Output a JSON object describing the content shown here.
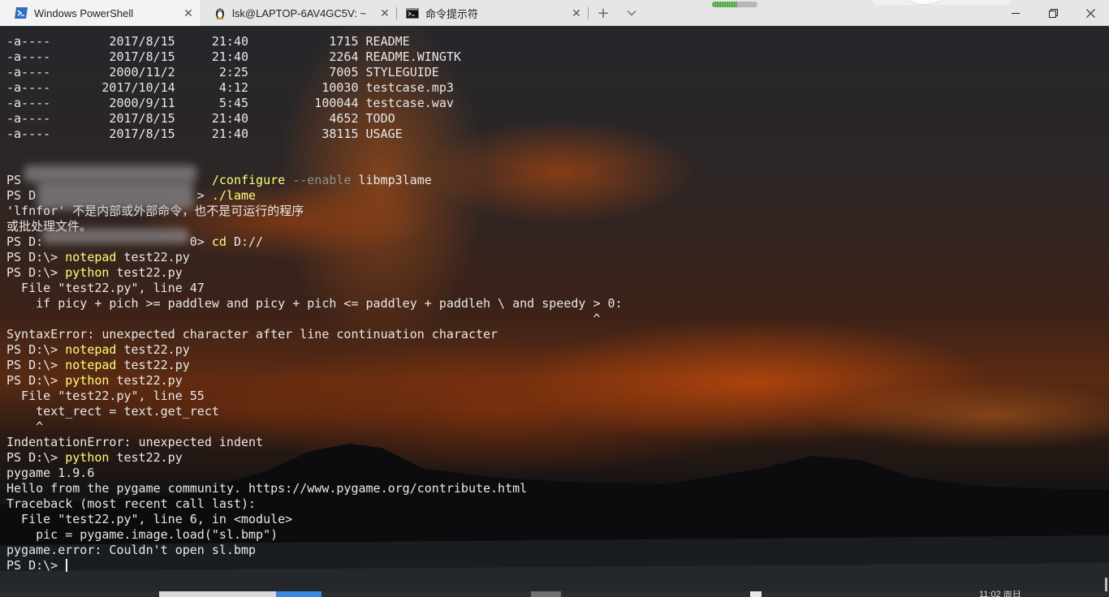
{
  "tabs": [
    {
      "title": "Windows PowerShell",
      "icon": "powershell-icon",
      "active": true
    },
    {
      "title": "lsk@LAPTOP-6AV4GC5V: ~",
      "icon": "linux-penguin-icon",
      "active": false
    },
    {
      "title": "命令提示符",
      "icon": "cmd-icon",
      "active": false
    }
  ],
  "tab_close_glyph": "✕",
  "new_tab_glyph": "+",
  "window_controls": [
    "minimize-icon",
    "restore-icon",
    "close-icon"
  ],
  "terminal": {
    "lines": [
      [
        {
          "t": "-a----        2017/8/15     21:40           1715 README"
        }
      ],
      [
        {
          "t": "-a----        2017/8/15     21:40           2264 README.WINGTK"
        }
      ],
      [
        {
          "t": "-a----        2000/11/2      2:25           7005 STYLEGUIDE"
        }
      ],
      [
        {
          "t": "-a----       2017/10/14      4:12          10030 testcase.mp3"
        }
      ],
      [
        {
          "t": "-a----        2000/9/11      5:45         100044 testcase.wav"
        }
      ],
      [
        {
          "t": "-a----        2017/8/15     21:40           4652 TODO"
        }
      ],
      [
        {
          "t": "-a----        2017/8/15     21:40          38115 USAGE"
        }
      ],
      [
        {
          "t": ""
        }
      ],
      [
        {
          "t": ""
        }
      ],
      [
        {
          "t": "PS                          "
        },
        {
          "t": "/configure",
          "c": "cmd"
        },
        {
          "t": " "
        },
        {
          "t": "--enable",
          "c": "flag"
        },
        {
          "t": " libmp3lame"
        }
      ],
      [
        {
          "t": "PS D                      > "
        },
        {
          "t": "./lame",
          "c": "cmd"
        }
      ],
      [
        {
          "t": "'lfnfor' 不是内部或外部命令，也不是可运行的程序"
        }
      ],
      [
        {
          "t": "或批处理文件。"
        }
      ],
      [
        {
          "t": "PS D:                    0> "
        },
        {
          "t": "cd",
          "c": "cmd"
        },
        {
          "t": " D://"
        }
      ],
      [
        {
          "t": "PS D:\\> "
        },
        {
          "t": "notepad",
          "c": "cmd"
        },
        {
          "t": " test22.py"
        }
      ],
      [
        {
          "t": "PS D:\\> "
        },
        {
          "t": "python",
          "c": "cmd"
        },
        {
          "t": " test22.py"
        }
      ],
      [
        {
          "t": "  File \"test22.py\", line 47"
        }
      ],
      [
        {
          "t": "    if picy + pich >= paddlew and picy + pich <= paddley + paddleh \\ and speedy > 0:"
        }
      ],
      [
        {
          "t": "                                                                                ^"
        }
      ],
      [
        {
          "t": "SyntaxError: unexpected character after line continuation character"
        }
      ],
      [
        {
          "t": "PS D:\\> "
        },
        {
          "t": "notepad",
          "c": "cmd"
        },
        {
          "t": " test22.py"
        }
      ],
      [
        {
          "t": "PS D:\\> "
        },
        {
          "t": "notepad",
          "c": "cmd"
        },
        {
          "t": " test22.py"
        }
      ],
      [
        {
          "t": "PS D:\\> "
        },
        {
          "t": "python",
          "c": "cmd"
        },
        {
          "t": " test22.py"
        }
      ],
      [
        {
          "t": "  File \"test22.py\", line 55"
        }
      ],
      [
        {
          "t": "    text_rect = text.get_rect"
        }
      ],
      [
        {
          "t": "    ^"
        }
      ],
      [
        {
          "t": "IndentationError: unexpected indent"
        }
      ],
      [
        {
          "t": "PS D:\\> "
        },
        {
          "t": "python",
          "c": "cmd"
        },
        {
          "t": " test22.py"
        }
      ],
      [
        {
          "t": "pygame 1.9.6"
        }
      ],
      [
        {
          "t": "Hello from the pygame community. https://www.pygame.org/contribute.html"
        }
      ],
      [
        {
          "t": "Traceback (most recent call last):"
        }
      ],
      [
        {
          "t": "  File \"test22.py\", line 6, in <module>"
        }
      ],
      [
        {
          "t": "    pic = pygame.image.load(\"sl.bmp\")"
        }
      ],
      [
        {
          "t": "pygame.error: Couldn't open sl.bmp"
        }
      ],
      [
        {
          "t": "PS D:\\> "
        }
      ]
    ]
  },
  "colors": {
    "text": "#e8e8e8",
    "command": "#ffff7a",
    "parameter": "#8f8f8f",
    "tabbar": "#e6e6e6",
    "active_tab": "#f3f3f3"
  },
  "taskbar_clock": "11:02 周日",
  "progress_level": 0.55
}
